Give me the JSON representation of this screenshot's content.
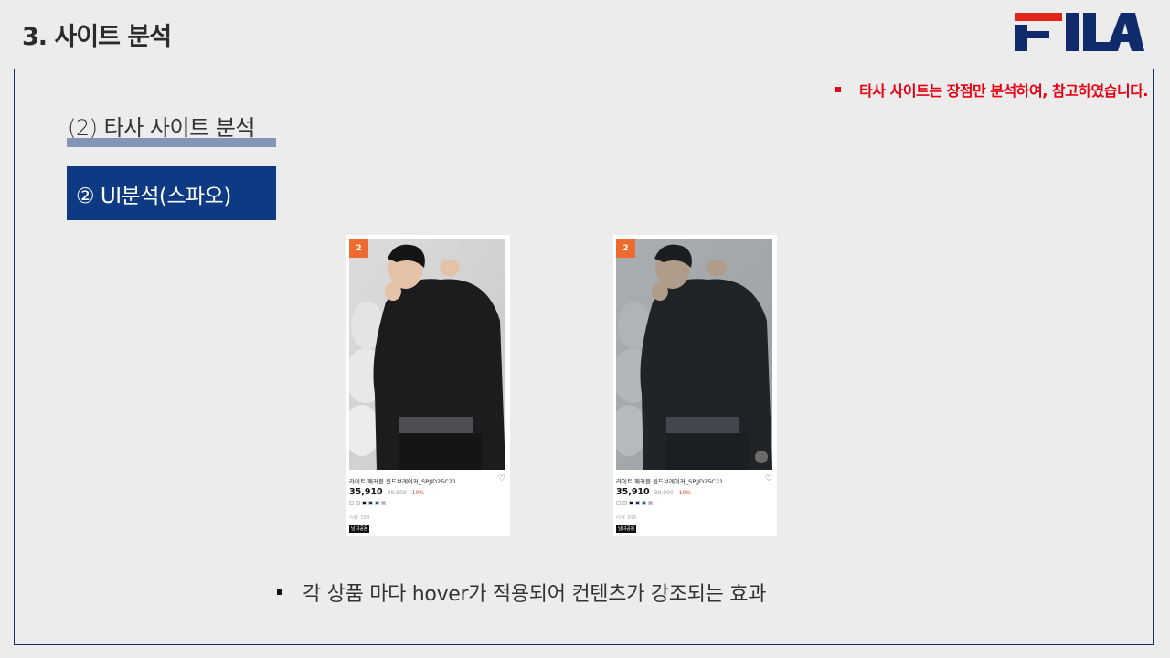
{
  "header": {
    "title": "3. 사이트 분석",
    "logo_text": "FILA",
    "logo_red": "#e2231a",
    "logo_navy": "#0f2b6b"
  },
  "note": {
    "text": "타사 사이트는 장점만 분석하여, 참고하였습니다."
  },
  "section": {
    "title": "(2) 타사 사이트 분석",
    "subsection": "② UI분석(스파오)"
  },
  "cards": [
    {
      "badge": "2",
      "name": "라이트 패커블 윈드브레이커_SPJJD25C21",
      "price": "35,910",
      "original_price": "39,900",
      "discount": "10%",
      "review": "리뷰 398",
      "tag": "남녀공용",
      "swatches": [
        "#f5f5f5",
        "#e8e8e8",
        "#111111",
        "#1f2f5e",
        "#0f6a6a",
        "#c7a3d4"
      ],
      "state": "default"
    },
    {
      "badge": "2",
      "name": "라이트 패커블 윈드브레이커_SPJJD25C21",
      "price": "35,910",
      "original_price": "39,900",
      "discount": "10%",
      "review": "리뷰 398",
      "tag": "남녀공용",
      "swatches": [
        "#f5f5f5",
        "#e8e8e8",
        "#111111",
        "#1f2f5e",
        "#0f6a6a",
        "#c7a3d4"
      ],
      "state": "hover"
    }
  ],
  "bottom": {
    "text": "각 상품 마다 hover가 적용되어 컨텐츠가 강조되는 효과"
  }
}
